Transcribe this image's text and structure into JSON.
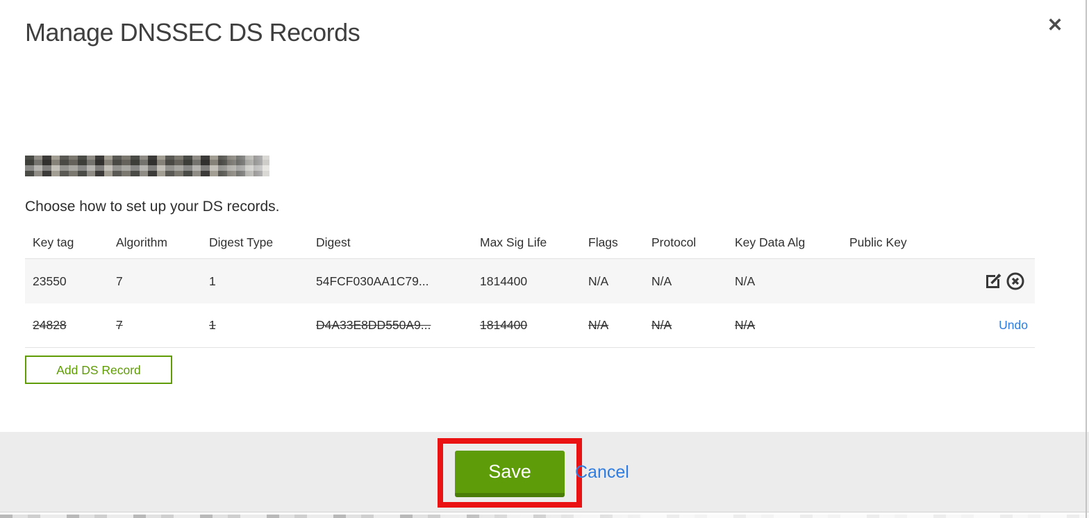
{
  "modal": {
    "title": "Manage DNSSEC DS Records",
    "instruction": "Choose how to set up your DS records.",
    "domain_redacted": true,
    "icons": {
      "close": "✕",
      "edit": "edit-pencil-square-icon",
      "delete": "circle-x-icon"
    },
    "table": {
      "headers": [
        "Key tag",
        "Algorithm",
        "Digest Type",
        "Digest",
        "Max Sig Life",
        "Flags",
        "Protocol",
        "Key Data Alg",
        "Public Key"
      ],
      "rows": [
        {
          "key_tag": "23550",
          "algorithm": "7",
          "digest_type": "1",
          "digest": "54FCF030AA1C79...",
          "max_sig_life": "1814400",
          "flags": "N/A",
          "protocol": "N/A",
          "key_data_alg": "N/A",
          "public_key": "",
          "state": "normal"
        },
        {
          "key_tag": "24828",
          "algorithm": "7",
          "digest_type": "1",
          "digest": "D4A33E8DD550A9...",
          "max_sig_life": "1814400",
          "flags": "N/A",
          "protocol": "N/A",
          "key_data_alg": "N/A",
          "public_key": "",
          "state": "deleted",
          "undo_label": "Undo"
        }
      ]
    },
    "add_button_label": "Add DS Record",
    "footer": {
      "save_label": "Save",
      "cancel_label": "Cancel"
    },
    "colors": {
      "button_green": "#5e9c09",
      "button_green_dark": "#4a7d07",
      "outline_green": "#5f9c06",
      "link_blue": "#2f7de1",
      "annotation_red": "#ea1212",
      "footer_gray": "#ececec",
      "row_stripe": "#f6f6f6"
    }
  }
}
